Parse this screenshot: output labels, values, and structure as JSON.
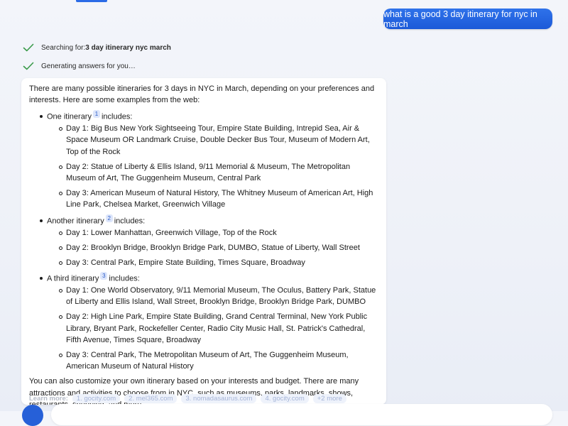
{
  "user_query": "what is a good 3 day itinerary for nyc in march",
  "status": {
    "searching_prefix": "Searching for: ",
    "searching_term": "3 day itinerary nyc march",
    "generating": "Generating answers for you…"
  },
  "answer": {
    "intro": "There are many possible itineraries for 3 days in NYC in March, depending on your preferences and interests. Here are some examples from the web:",
    "itineraries": [
      {
        "label": "One itinerary",
        "cite": "1",
        "suffix": "includes:",
        "days": [
          "Day 1: Big Bus New York Sightseeing Tour, Empire State Building, Intrepid Sea, Air & Space Museum OR Landmark Cruise, Double Decker Bus Tour, Museum of Modern Art, Top of the Rock",
          "Day 2: Statue of Liberty & Ellis Island, 9/11 Memorial & Museum, The Metropolitan Museum of Art, The Guggenheim Museum, Central Park",
          "Day 3: American Museum of Natural History, The Whitney Museum of American Art, High Line Park, Chelsea Market, Greenwich Village"
        ]
      },
      {
        "label": "Another itinerary",
        "cite": "2",
        "suffix": "includes:",
        "days": [
          "Day 1: Lower Manhattan, Greenwich Village, Top of the Rock",
          "Day 2: Brooklyn Bridge, Brooklyn Bridge Park, DUMBO, Statue of Liberty, Wall Street",
          "Day 3: Central Park, Empire State Building, Times Square, Broadway"
        ]
      },
      {
        "label": "A third itinerary",
        "cite": "3",
        "suffix": "includes:",
        "days": [
          "Day 1: One World Observatory, 9/11 Memorial Museum, The Oculus, Battery Park, Statue of Liberty and Ellis Island, Wall Street, Brooklyn Bridge, Brooklyn Bridge Park, DUMBO",
          "Day 2: High Line Park, Empire State Building, Grand Central Terminal, New York Public Library, Bryant Park, Rockefeller Center, Radio City Music Hall, St. Patrick's Cathedral, Fifth Avenue, Times Square, Broadway",
          "Day 3: Central Park, The Metropolitan Museum of Art, The Guggenheim Museum, American Museum of Natural History"
        ]
      }
    ],
    "closing": "You can also customize your own itinerary based on your interests and budget. There are many attractions and activities to choose from in NYC, such as museums, parks, landmarks, shows, restaurants, shopping, and more."
  },
  "learn_more": {
    "title": "Learn more:",
    "links": [
      "1. gocity.com",
      "2. mel365.com",
      "3. nomadasaurus.com",
      "4. gocity.com",
      "+2 more"
    ]
  },
  "colors": {
    "accent": "#2b6be6",
    "user_bubble": "#1c5ad8",
    "check": "#3a9a4a"
  },
  "icons": {
    "status_check": "check-icon"
  }
}
